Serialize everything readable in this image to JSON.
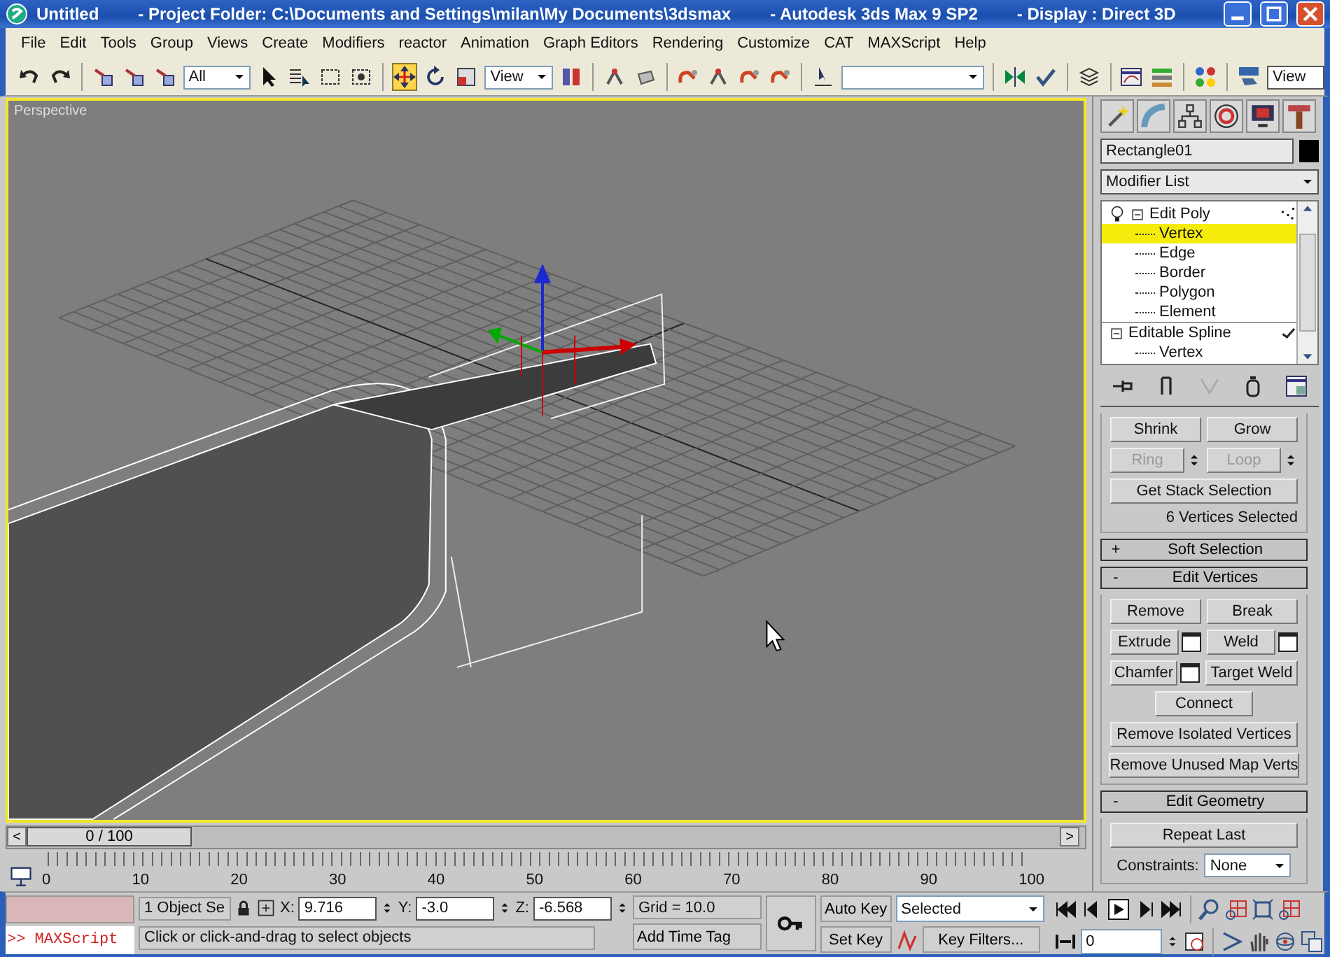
{
  "window": {
    "title_parts": [
      "Untitled",
      "- Project Folder: C:\\Documents and Settings\\milan\\My Documents\\3dsmax",
      "- Autodesk 3ds Max 9 SP2",
      "- Display : Direct 3D"
    ]
  },
  "menu": [
    "File",
    "Edit",
    "Tools",
    "Group",
    "Views",
    "Create",
    "Modifiers",
    "reactor",
    "Animation",
    "Graph Editors",
    "Rendering",
    "Customize",
    "CAT",
    "MAXScript",
    "Help"
  ],
  "toolbar": {
    "selection_filter": "All",
    "reference_coordinate_system": "View",
    "viewport_layout": "View",
    "transform_tools": [
      {
        "kind": "move",
        "selected": true
      },
      {
        "kind": "rotate",
        "selected": false
      },
      {
        "kind": "scale",
        "selected": false
      }
    ]
  },
  "viewport": {
    "label": "Perspective",
    "active": true
  },
  "command_panel": {
    "object_name": "Rectangle01",
    "modifier_list": "Modifier List",
    "stack": [
      {
        "label": "Edit Poly",
        "children": [
          {
            "label": "Vertex",
            "selected": true
          },
          {
            "label": "Edge",
            "selected": false
          },
          {
            "label": "Border",
            "selected": false
          },
          {
            "label": "Polygon",
            "selected": false
          },
          {
            "label": "Element",
            "selected": false
          }
        ]
      },
      {
        "label": "Editable Spline",
        "children": [
          {
            "label": "Vertex",
            "selected": false
          }
        ]
      }
    ],
    "selection_rollout": {
      "rows": [
        [
          {
            "kind": "button",
            "label": "Shrink",
            "disabled": false
          },
          {
            "kind": "button",
            "label": "Grow",
            "disabled": false
          }
        ],
        [
          {
            "kind": "spinner",
            "label": "Ring",
            "disabled": true
          },
          {
            "kind": "spinner",
            "label": "Loop",
            "disabled": true
          }
        ],
        [
          {
            "kind": "button",
            "label": "Get Stack Selection",
            "disabled": false
          }
        ]
      ],
      "status": "6 Vertices Selected"
    },
    "rollouts": [
      {
        "toggle": "+",
        "title": "Soft Selection"
      },
      {
        "toggle": "-",
        "title": "Edit Vertices",
        "rows": [
          [
            {
              "kind": "button",
              "label": "Remove",
              "disabled": false
            },
            {
              "kind": "button",
              "label": "Break",
              "disabled": false
            }
          ],
          [
            {
              "kind": "settings",
              "label": "Extrude",
              "disabled": false
            },
            {
              "kind": "settings",
              "label": "Weld",
              "disabled": false
            }
          ],
          [
            {
              "kind": "settings",
              "label": "Chamfer",
              "disabled": false
            },
            {
              "kind": "button",
              "label": "Target Weld",
              "disabled": false
            }
          ],
          [
            {
              "kind": "small",
              "label": "Connect",
              "disabled": false
            }
          ],
          [
            {
              "kind": "button",
              "label": "Remove Isolated Vertices",
              "disabled": false
            }
          ],
          [
            {
              "kind": "button",
              "label": "Remove Unused Map Verts",
              "disabled": false
            }
          ]
        ]
      },
      {
        "toggle": "-",
        "title": "Edit Geometry",
        "rows": [
          [
            {
              "kind": "button",
              "label": "Repeat Last",
              "disabled": false
            }
          ]
        ],
        "constraints": {
          "label": "Constraints:",
          "value": "None"
        }
      }
    ]
  },
  "timeline": {
    "prev": "<",
    "next": ">",
    "frame_counter": "0 / 100",
    "level": 0,
    "ticks": [
      "0",
      "10",
      "20",
      "30",
      "40",
      "50",
      "60",
      "70",
      "80",
      "90",
      "100"
    ]
  },
  "status": {
    "maxscript": ">> MAXScript",
    "selection": "1 Object Se",
    "coords": [
      {
        "axis": "X:",
        "value": "9.716"
      },
      {
        "axis": "Y:",
        "value": "-3.0"
      },
      {
        "axis": "Z:",
        "value": "-6.568"
      }
    ],
    "grid": "Grid = 10.0",
    "prompt": "Click or click-and-drag to select objects",
    "add_time_tag": "Add Time Tag",
    "auto_key": "Auto Key",
    "set_key": "Set Key",
    "key_mode": "Selected",
    "key_filters": "Key Filters...",
    "current_frame": "0"
  }
}
